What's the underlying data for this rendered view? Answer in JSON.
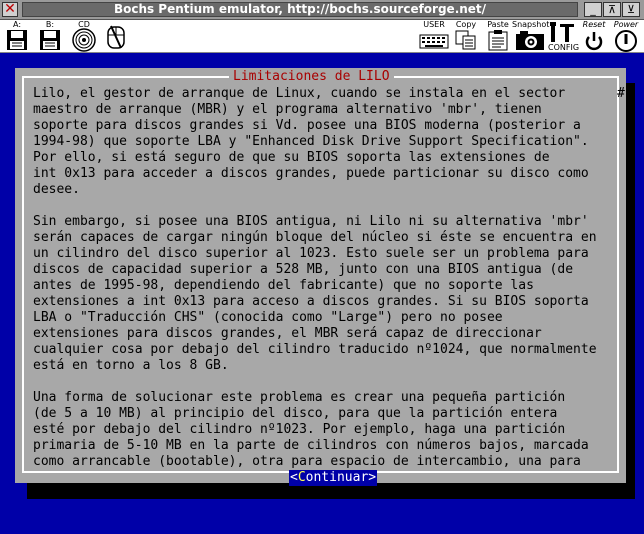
{
  "window": {
    "title": "Bochs Pentium emulator, http://bochs.sourceforge.net/"
  },
  "toolbar": {
    "items": [
      {
        "label": "A:",
        "icon": "floppy-a-icon"
      },
      {
        "label": "B:",
        "icon": "floppy-b-icon"
      },
      {
        "label": "CD",
        "icon": "cdrom-icon"
      },
      {
        "label": "",
        "icon": "mouse-icon"
      },
      {
        "label": "USER",
        "icon": "keyboard-icon"
      },
      {
        "label": "Copy",
        "icon": "copy-icon"
      },
      {
        "label": "Paste",
        "icon": "paste-icon"
      },
      {
        "label": "Snapshot",
        "icon": "camera-icon"
      },
      {
        "label": "CONFIG",
        "icon": "config-icon"
      },
      {
        "label": "Reset",
        "icon": "reset-icon"
      },
      {
        "label": "Power",
        "icon": "power-icon"
      }
    ]
  },
  "dialog": {
    "title": "Limitaciones de LILO",
    "scroll_marker": "#",
    "lines": [
      "Lilo, el gestor de arranque de Linux, cuando se instala en el sector",
      "maestro de arranque (MBR) y el programa alternativo 'mbr', tienen",
      "soporte para discos grandes si Vd. posee una BIOS moderna (posterior a",
      "1994-98) que soporte LBA y \"Enhanced Disk Drive Support Specification\".",
      "Por ello, si está seguro de que su BIOS soporta las extensiones de",
      "int 0x13 para acceder a discos grandes, puede particionar su disco como",
      "desee.",
      "",
      "Sin embargo, si posee una BIOS antigua, ni Lilo ni su alternativa 'mbr'",
      "serán capaces de cargar ningún bloque del núcleo si éste se encuentra en",
      "un cilindro del disco superior al 1023. Esto suele ser un problema para",
      "discos de capacidad superior a 528 MB, junto con una BIOS antigua (de",
      "antes de 1995-98, dependiendo del fabricante) que no soporte las",
      "extensiones a int 0x13 para acceso a discos grandes. Si su BIOS soporta",
      "LBA o \"Traducción CHS\" (conocida como \"Large\") pero no posee",
      "extensiones para discos grandes, el MBR será capaz de direccionar",
      "cualquier cosa por debajo del cilindro traducido nº1024, que normalmente",
      "está en torno a los 8 GB.",
      "",
      "Una forma de solucionar este problema es crear una pequeña partición",
      "(de 5 a 10 MB) al principio del disco, para que la partición entera",
      "esté por debajo del cilindro nº1023. Por ejemplo, haga una partición",
      "primaria de 5-10 MB en la parte de cilindros con números bajos, marcada",
      "como arrancable (bootable), otra para espacio de intercambio, una para"
    ],
    "button": {
      "open": "<",
      "hot": "C",
      "rest": "ontinuar",
      "close": ">"
    }
  },
  "colors": {
    "background": "#0000a8",
    "dialog": "#a8a8a8",
    "title_text": "#a80000",
    "button_bg": "#0000a8"
  }
}
